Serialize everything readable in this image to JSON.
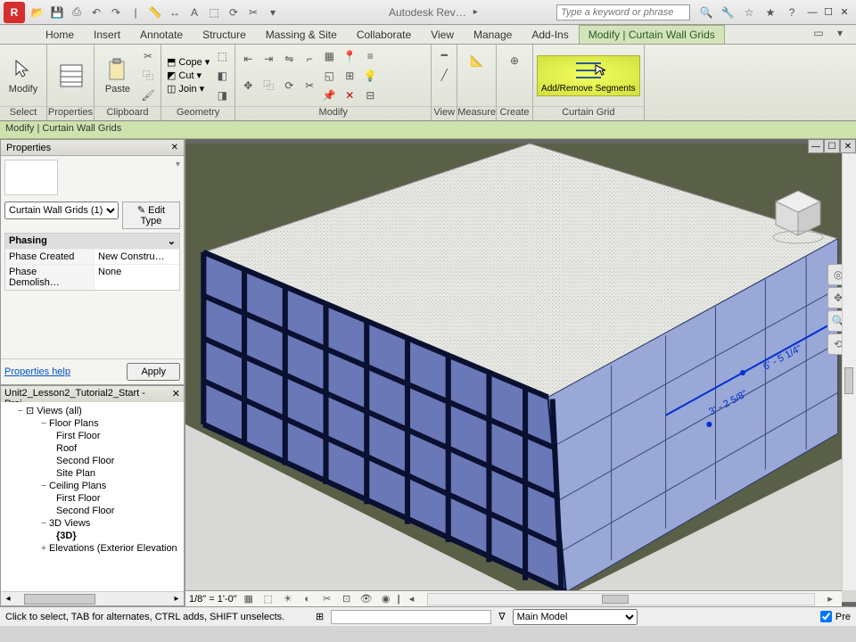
{
  "app": {
    "icon_letter": "R",
    "title": "Autodesk Rev…",
    "search_placeholder": "Type a keyword or phrase"
  },
  "qat": [
    "open",
    "save",
    "print",
    "undo",
    "redo",
    "sep",
    "measure",
    "align",
    "text",
    "3d",
    "sync",
    "section"
  ],
  "tabs": [
    "Home",
    "Insert",
    "Annotate",
    "Structure",
    "Massing & Site",
    "Collaborate",
    "View",
    "Manage",
    "Add-Ins",
    "Modify | Curtain Wall Grids"
  ],
  "active_tab": 9,
  "ribbon": {
    "panels": [
      {
        "label": "Select",
        "big": [
          {
            "name": "modify",
            "label": "Modify"
          }
        ]
      },
      {
        "label": "Properties",
        "big": [
          {
            "name": "properties",
            "label": ""
          }
        ]
      },
      {
        "label": "Clipboard",
        "big": [
          {
            "name": "paste",
            "label": "Paste"
          }
        ],
        "rows": []
      },
      {
        "label": "Geometry",
        "rows": [
          {
            "icon": "cope",
            "label": "Cope",
            "dd": true
          },
          {
            "icon": "cut",
            "label": "Cut",
            "dd": true
          },
          {
            "icon": "join",
            "label": "Join",
            "dd": true
          }
        ],
        "extras": 3
      },
      {
        "label": "Modify",
        "grid_cols": 6
      },
      {
        "label": "View",
        "grid_cols": 1
      },
      {
        "label": "Measure",
        "grid_cols": 1
      },
      {
        "label": "Create",
        "grid_cols": 1
      },
      {
        "label": "Curtain Grid",
        "big": [
          {
            "name": "addremove",
            "label": "Add/Remove Segments",
            "highlight": true
          }
        ]
      }
    ]
  },
  "context_label": "Modify | Curtain Wall Grids",
  "properties": {
    "title": "Properties",
    "type_selector": "Curtain Wall Grids (1)",
    "edit_type": "Edit Type",
    "group": "Phasing",
    "rows": [
      {
        "k": "Phase Created",
        "v": "New Constru…"
      },
      {
        "k": "Phase Demolish…",
        "v": "None"
      }
    ],
    "help": "Properties help",
    "apply": "Apply"
  },
  "browser": {
    "title": "Unit2_Lesson2_Tutorial2_Start - Proj…",
    "tree": [
      {
        "d": 1,
        "tw": "−",
        "label": "Views (all)",
        "bold": false,
        "box": true
      },
      {
        "d": 2,
        "tw": "−",
        "label": "Floor Plans"
      },
      {
        "d": 3,
        "tw": "",
        "label": "First Floor"
      },
      {
        "d": 3,
        "tw": "",
        "label": "Roof"
      },
      {
        "d": 3,
        "tw": "",
        "label": "Second Floor"
      },
      {
        "d": 3,
        "tw": "",
        "label": "Site Plan"
      },
      {
        "d": 2,
        "tw": "−",
        "label": "Ceiling Plans"
      },
      {
        "d": 3,
        "tw": "",
        "label": "First Floor"
      },
      {
        "d": 3,
        "tw": "",
        "label": "Second Floor"
      },
      {
        "d": 2,
        "tw": "−",
        "label": "3D Views"
      },
      {
        "d": 3,
        "tw": "",
        "label": "{3D}",
        "bold": true
      },
      {
        "d": 2,
        "tw": "+",
        "label": "Elevations (Exterior Elevation"
      }
    ]
  },
  "viewbar": {
    "scale": "1/8\" = 1'-0\""
  },
  "status": {
    "msg": "Click to select, TAB for alternates, CTRL adds, SHIFT unselects.",
    "model": "Main Model",
    "press": "Pre"
  },
  "drawing": {
    "dim1": "6' - 5 1/4\"",
    "dim2": "3' - 2 5/8\""
  }
}
